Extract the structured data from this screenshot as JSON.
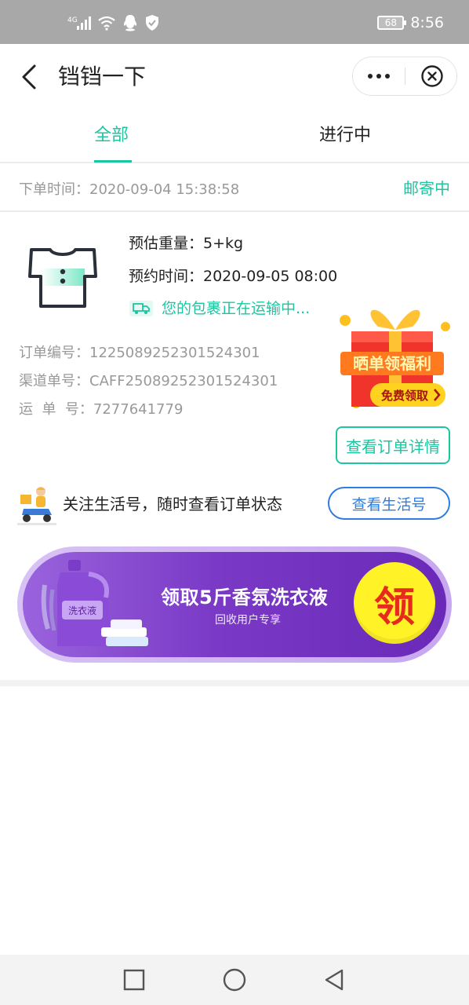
{
  "status_bar": {
    "network": "4G",
    "battery": "68",
    "time": "8:56",
    "icons": [
      "signal-icon",
      "wifi-icon",
      "qq-icon",
      "shield-icon"
    ]
  },
  "header": {
    "title": "铛铛一下",
    "icons": [
      "back-arrow-icon",
      "more-dots-icon",
      "close-circle-icon"
    ]
  },
  "tabs": [
    {
      "label": "全部",
      "active": true
    },
    {
      "label": "进行中",
      "active": false
    }
  ],
  "order": {
    "time_label": "下单时间：2020-09-04 15:38:58",
    "status": "邮寄中",
    "weight": "预估重量：5+kg",
    "appointment": "预约时间：2020-09-05 08:00",
    "shipping_status": "您的包裹正在运输中...",
    "order_no": "订单编号：1225089252301524301",
    "channel_no": "渠道单号：CAFF25089252301524301",
    "tracking_no": "运  单  号：7277641779",
    "detail_button": "查看订单详情",
    "gift_promo": {
      "title": "晒单领福利",
      "button": "免费领取"
    }
  },
  "follow": {
    "text": "关注生活号，随时查看订单状态",
    "button": "查看生活号"
  },
  "banner": {
    "title": "领取5斤香氛洗衣液",
    "subtitle": "回收用户专享",
    "badge": "领",
    "product_label": "洗衣液"
  },
  "colors": {
    "accent": "#1cc6a0",
    "link_blue": "#2f7de0",
    "banner_purple": "#7a3ac6",
    "badge_yellow": "#fff227",
    "badge_red": "#e62a1c"
  },
  "navbar": {
    "icons": [
      "recent-apps-icon",
      "home-icon",
      "back-triangle-icon"
    ]
  }
}
